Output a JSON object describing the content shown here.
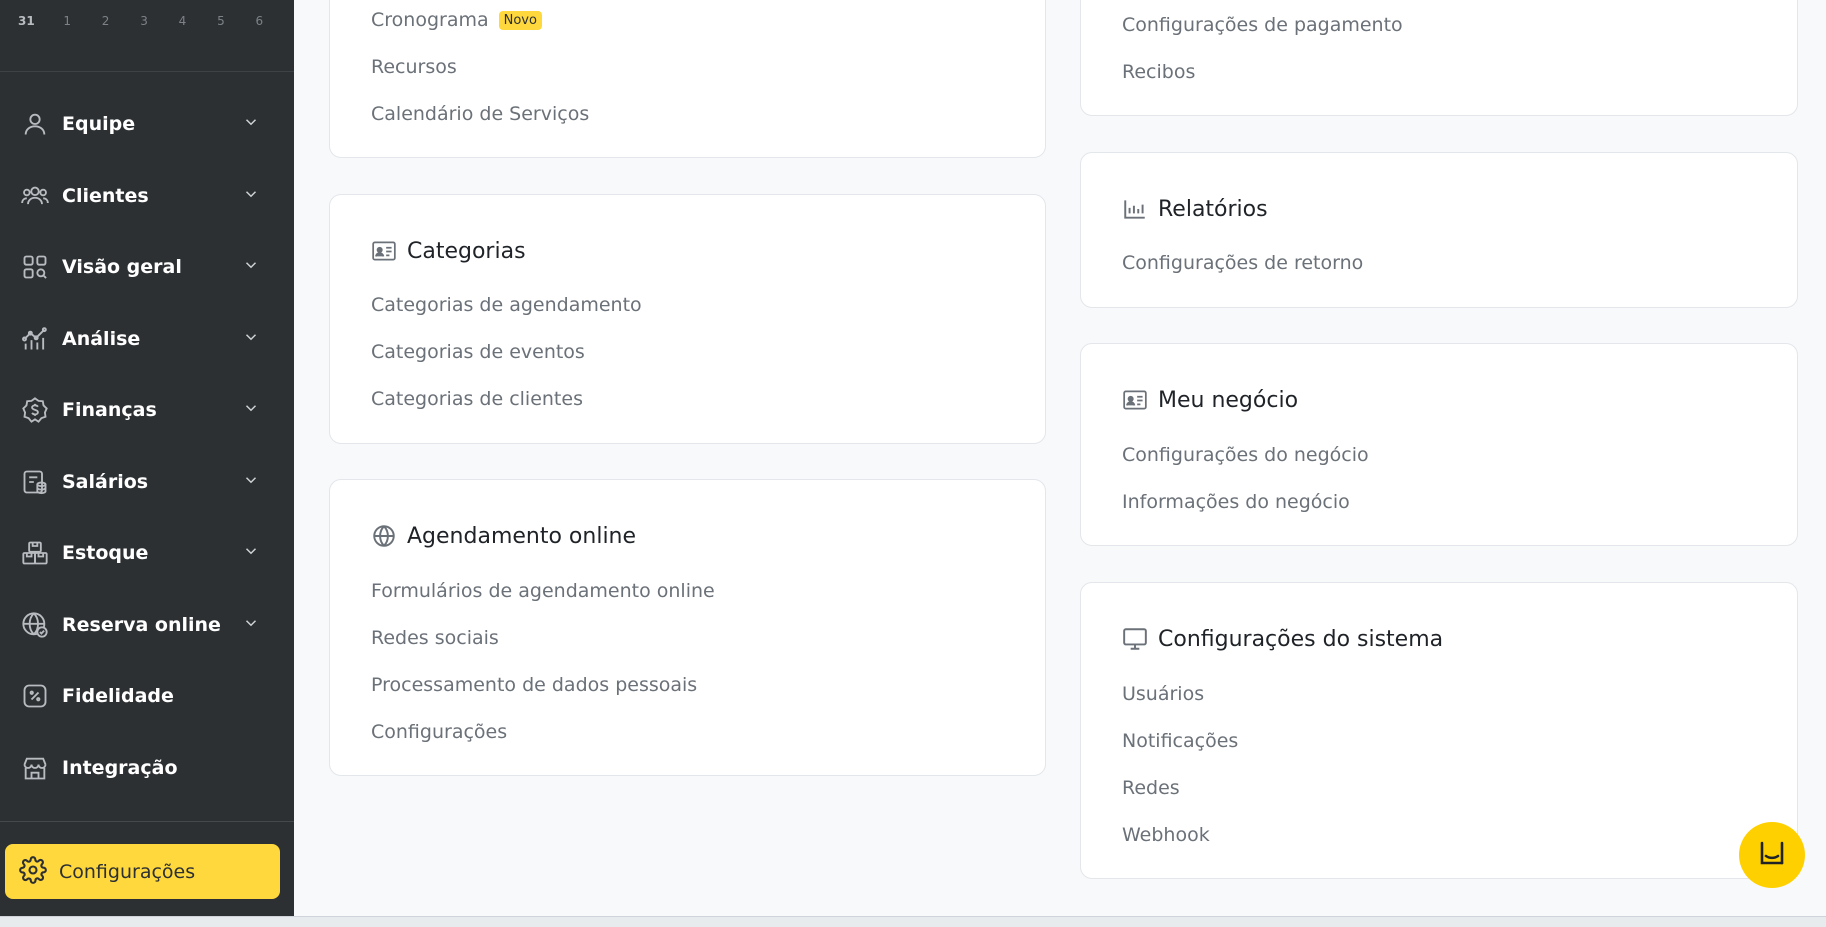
{
  "calendar_strip": [
    "31",
    "1",
    "2",
    "3",
    "4",
    "5",
    "6"
  ],
  "sidebar": {
    "items": [
      {
        "label": "Equipe",
        "icon": "user-icon",
        "expandable": true
      },
      {
        "label": "Clientes",
        "icon": "users-icon",
        "expandable": true
      },
      {
        "label": "Visão geral",
        "icon": "grid-search-icon",
        "expandable": true
      },
      {
        "label": "Análise",
        "icon": "analytics-icon",
        "expandable": true
      },
      {
        "label": "Finanças",
        "icon": "dollar-badge-icon",
        "expandable": true
      },
      {
        "label": "Salários",
        "icon": "payroll-icon",
        "expandable": true
      },
      {
        "label": "Estoque",
        "icon": "boxes-icon",
        "expandable": true
      },
      {
        "label": "Reserva online",
        "icon": "globe-check-icon",
        "expandable": true
      },
      {
        "label": "Fidelidade",
        "icon": "percent-icon",
        "expandable": false
      },
      {
        "label": "Integração",
        "icon": "storefront-icon",
        "expandable": false
      }
    ],
    "settings_label": "Configurações"
  },
  "cards": {
    "top_left": {
      "links": [
        "Cronograma",
        "Recursos",
        "Calendário de Serviços"
      ],
      "badge": "Novo"
    },
    "categorias": {
      "title": "Categorias",
      "links": [
        "Categorias de agendamento",
        "Categorias de eventos",
        "Categorias de clientes"
      ]
    },
    "agendamento": {
      "title": "Agendamento online",
      "links": [
        "Formulários de agendamento online",
        "Redes sociais",
        "Processamento de dados pessoais",
        "Configurações"
      ]
    },
    "top_right": {
      "links": [
        "Configurações de pagamento",
        "Recibos"
      ]
    },
    "relatorios": {
      "title": "Relatórios",
      "links": [
        "Configurações de retorno"
      ]
    },
    "negocio": {
      "title": "Meu negócio",
      "links": [
        "Configurações do negócio",
        "Informações do negócio"
      ]
    },
    "sistema": {
      "title": "Configurações do sistema",
      "links": [
        "Usuários",
        "Notificações",
        "Redes",
        "Webhook"
      ]
    }
  },
  "colors": {
    "sidebar_bg": "#2c3033",
    "accent": "#ffd83d",
    "link_text": "#6b7178"
  }
}
